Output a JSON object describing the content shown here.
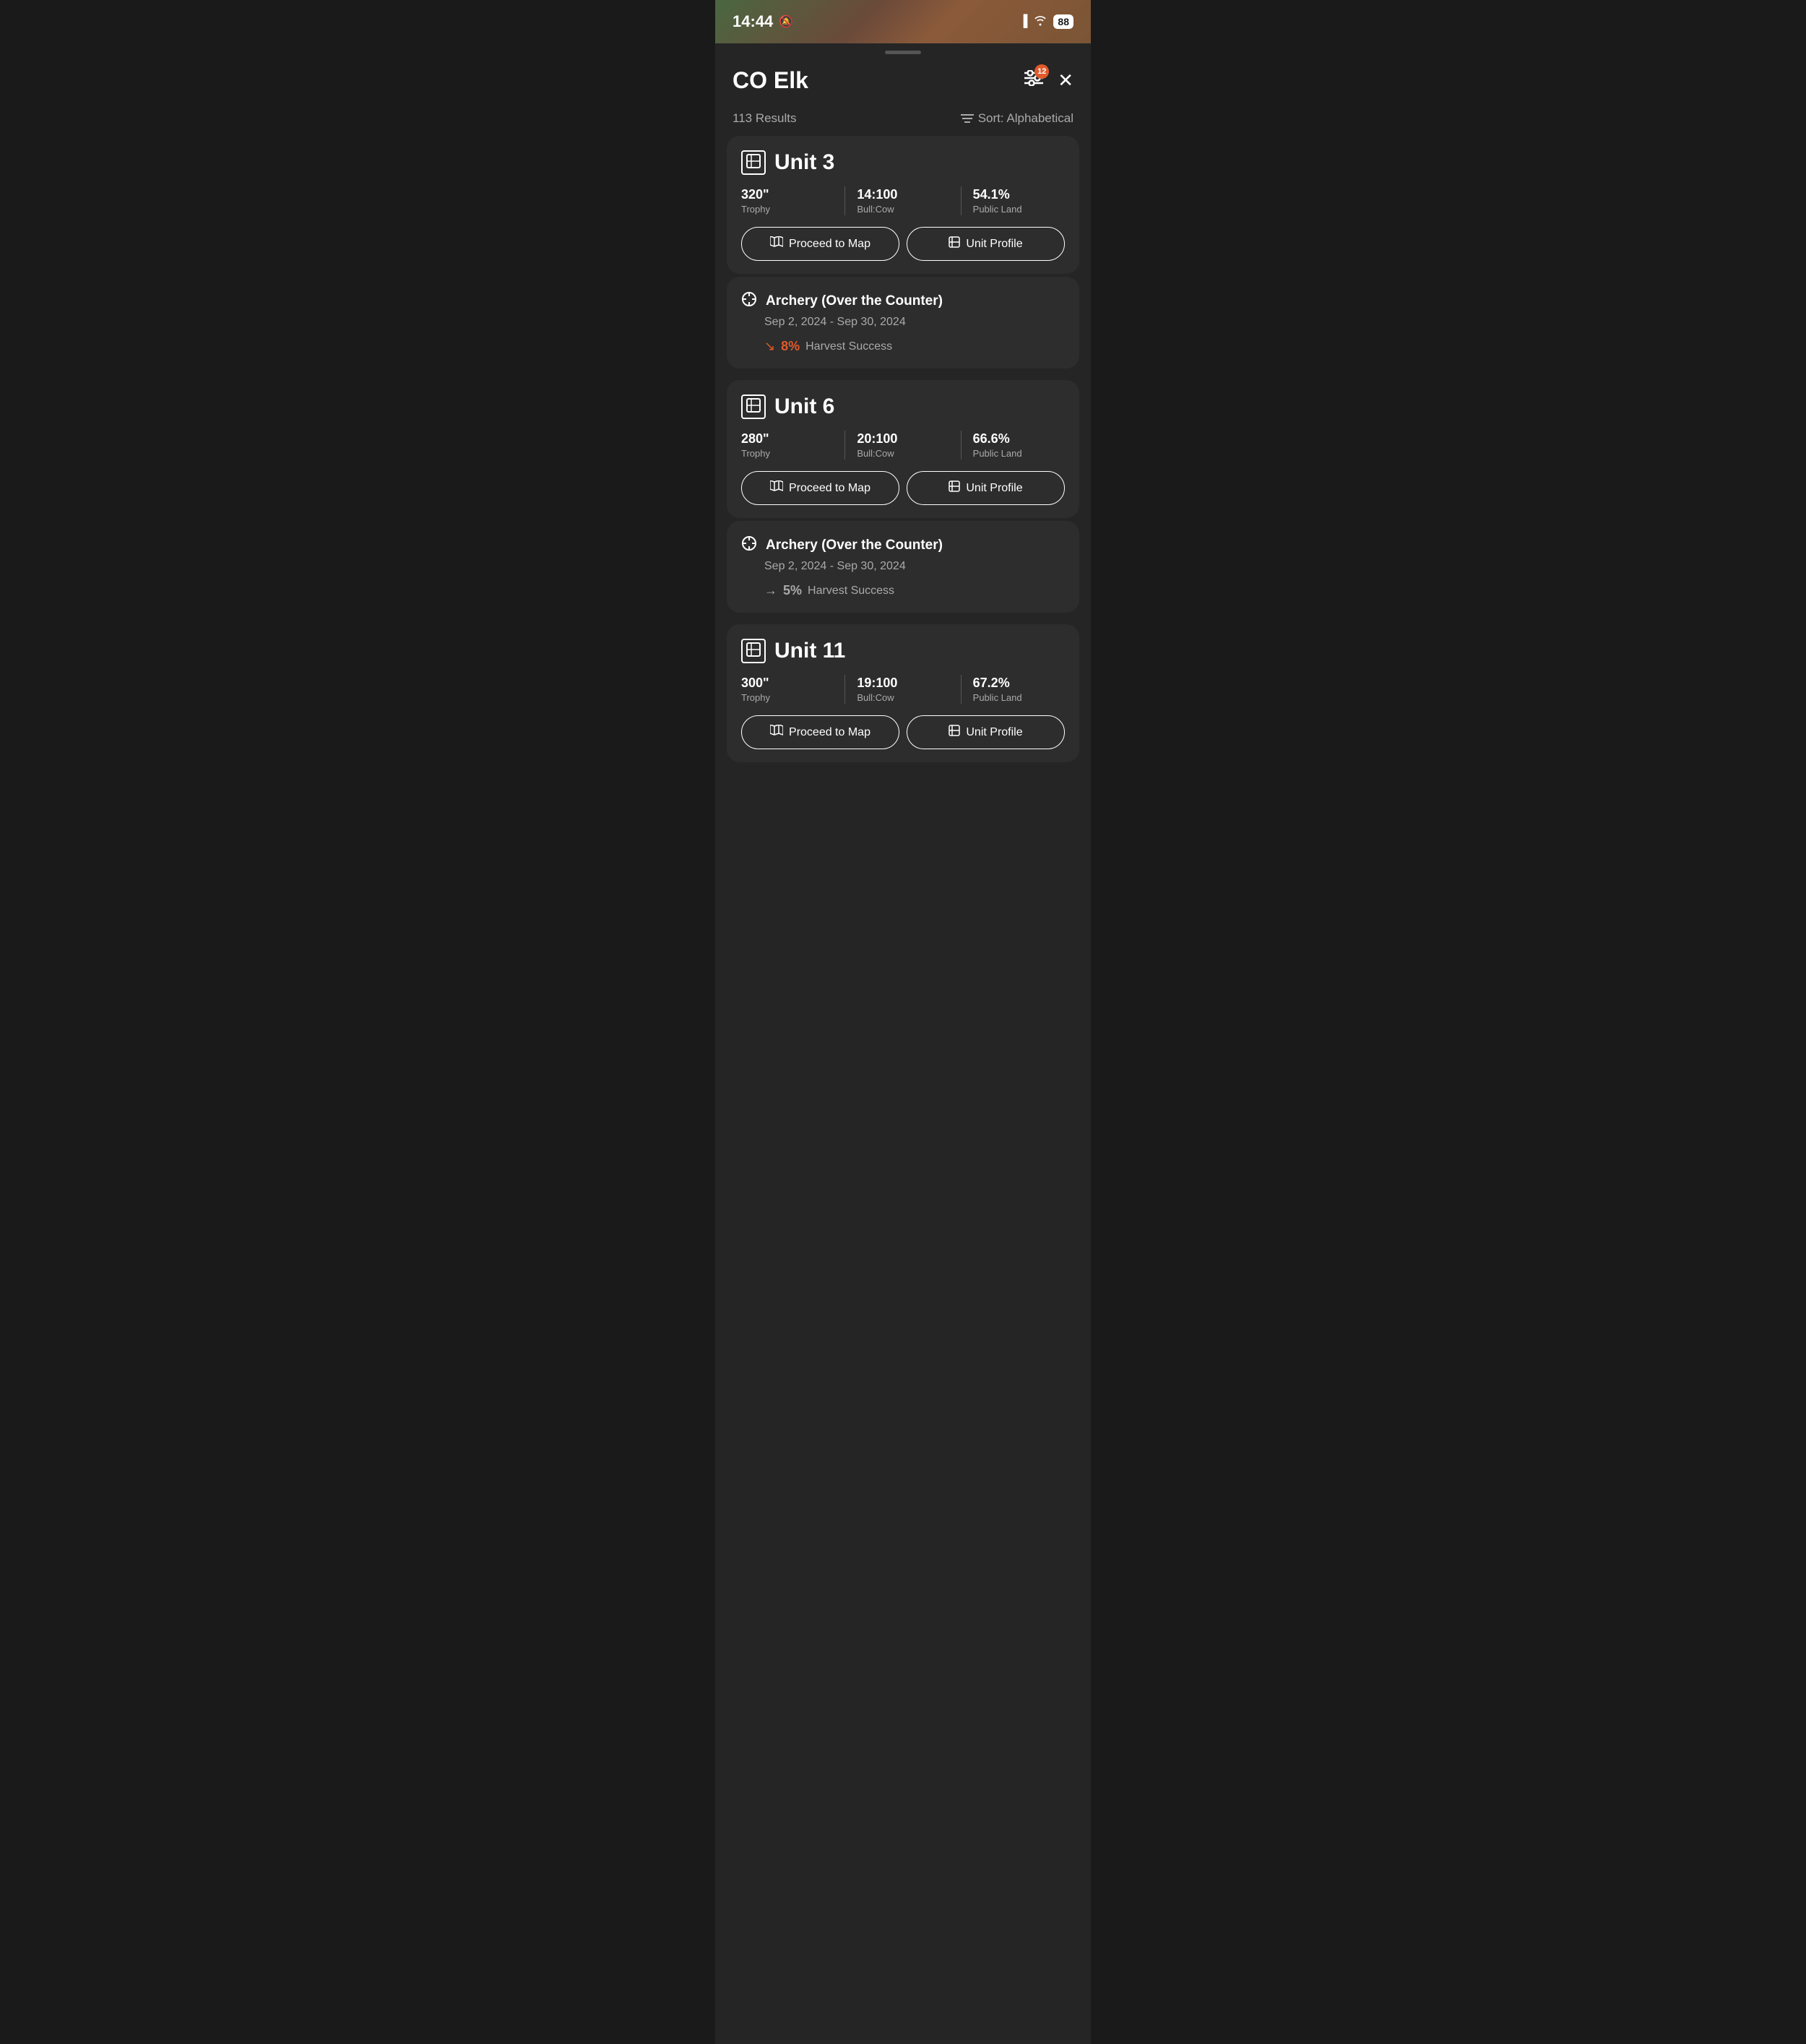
{
  "statusBar": {
    "time": "14:44",
    "bellIcon": "🔔",
    "signal": "📶",
    "wifi": "WiFi",
    "battery": "88"
  },
  "header": {
    "title": "CO Elk",
    "filterBadge": "12",
    "closeLabel": "✕"
  },
  "results": {
    "count": "113 Results",
    "sortLabel": "Sort: Alphabetical"
  },
  "units": [
    {
      "name": "Unit 3",
      "stats": [
        {
          "value": "320\"",
          "label": "Trophy"
        },
        {
          "value": "14:100",
          "label": "Bull:Cow"
        },
        {
          "value": "54.1%",
          "label": "Public Land"
        }
      ],
      "proceedBtn": "Proceed to Map",
      "profileBtn": "Unit Profile",
      "season": {
        "title": "Archery (Over the Counter)",
        "dates": "Sep 2, 2024 - Sep 30, 2024",
        "harvestPct": "8%",
        "harvestLabel": "Harvest Success",
        "harvestType": "down"
      }
    },
    {
      "name": "Unit 6",
      "stats": [
        {
          "value": "280\"",
          "label": "Trophy"
        },
        {
          "value": "20:100",
          "label": "Bull:Cow"
        },
        {
          "value": "66.6%",
          "label": "Public Land"
        }
      ],
      "proceedBtn": "Proceed to Map",
      "profileBtn": "Unit Profile",
      "season": {
        "title": "Archery (Over the Counter)",
        "dates": "Sep 2, 2024 - Sep 30, 2024",
        "harvestPct": "5%",
        "harvestLabel": "Harvest Success",
        "harvestType": "flat"
      }
    },
    {
      "name": "Unit 11",
      "stats": [
        {
          "value": "300\"",
          "label": "Trophy"
        },
        {
          "value": "19:100",
          "label": "Bull:Cow"
        },
        {
          "value": "67.2%",
          "label": "Public Land"
        }
      ],
      "proceedBtn": "Proceed to Map",
      "profileBtn": "Unit Profile",
      "season": null
    }
  ]
}
